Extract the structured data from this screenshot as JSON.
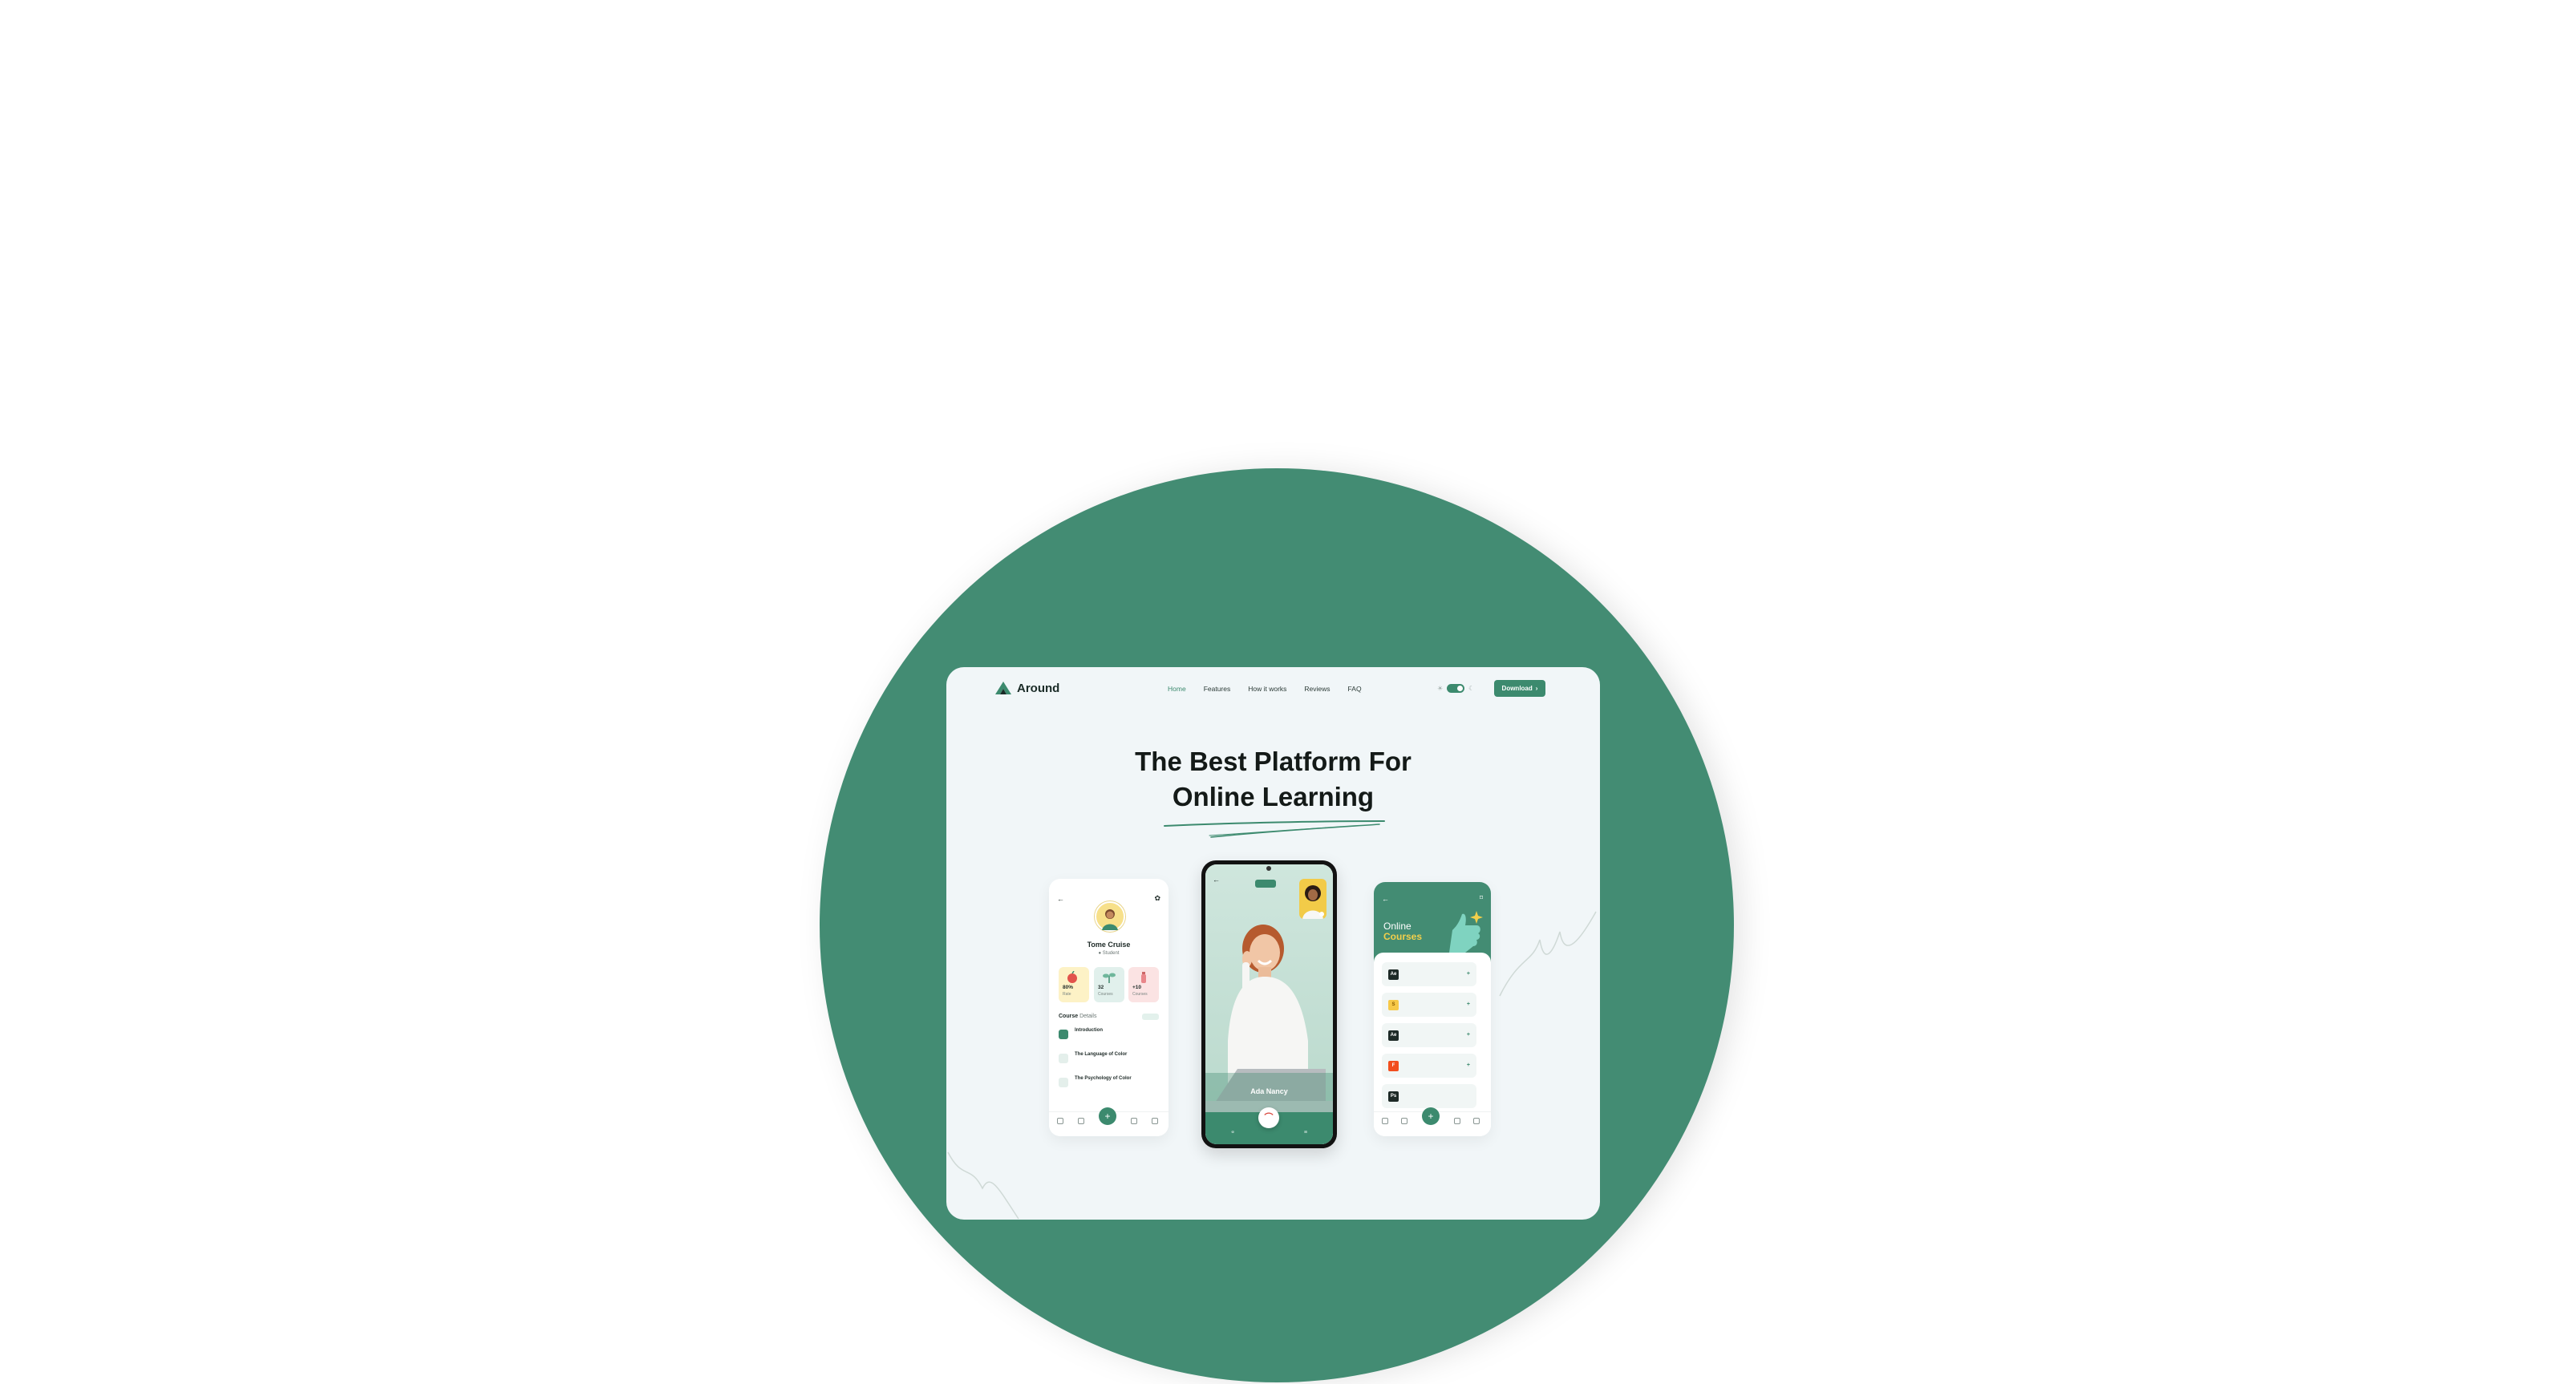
{
  "colors": {
    "brand": "#438c73",
    "accent": "#3c8a6e",
    "yellow": "#f2cf4b",
    "page_bg": "#f1f6f8"
  },
  "header": {
    "brand": "Around",
    "nav": [
      "Home",
      "Features",
      "How it works",
      "Reviews",
      "FAQ"
    ],
    "download_label": "Download",
    "download_icon": "arrow-right-icon"
  },
  "hero": {
    "line1": "The Best Platform For",
    "line2": "Online Learning"
  },
  "profile_phone": {
    "name": "Tome Cruise",
    "role": "Student",
    "stats": [
      {
        "value": "80%",
        "label": "Rate"
      },
      {
        "value": "32",
        "label": "Courses"
      },
      {
        "value": "+10",
        "label": "Courses"
      }
    ],
    "section_bold": "Course",
    "section_rest": "Details",
    "lessons": [
      {
        "title": "Introduction",
        "subtitle": ""
      },
      {
        "title": "The Language of Color",
        "subtitle": ""
      },
      {
        "title": "The Psychology of Color",
        "subtitle": ""
      }
    ],
    "nav": [
      "Home",
      "",
      "",
      "",
      "Profile"
    ]
  },
  "call_phone": {
    "name": "Ada Nancy"
  },
  "courses_phone": {
    "title_1": "Online",
    "title_2": "Courses",
    "courses": [
      {
        "icon": "Ae",
        "title": "",
        "price": ""
      },
      {
        "icon": "S",
        "title": "",
        "price": ""
      },
      {
        "icon": "Ae",
        "title": "",
        "price": ""
      },
      {
        "icon": "F",
        "title": "",
        "price": ""
      },
      {
        "icon": "Ps",
        "title": "",
        "price": ""
      }
    ]
  }
}
